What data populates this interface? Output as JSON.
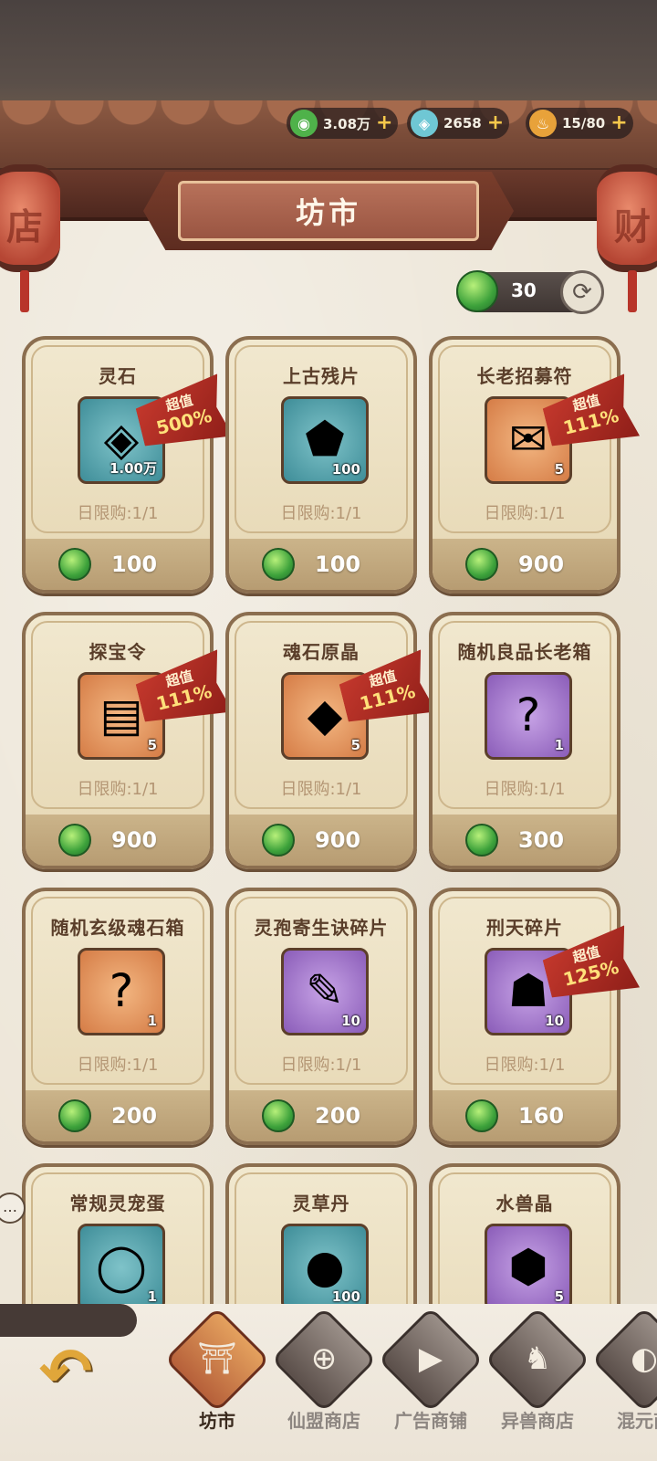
{
  "currencies": [
    {
      "icon": "jade-icon",
      "value": "3.08万",
      "color": "#4fb24a"
    },
    {
      "icon": "spirit-stone-icon",
      "value": "2658",
      "color": "#6fc7d4"
    },
    {
      "icon": "stamina-flame-icon",
      "value": "15/80",
      "color": "#e8a23a"
    }
  ],
  "lanterns": {
    "left": "店",
    "right": "财"
  },
  "title": "坊市",
  "refresh": {
    "cost": "30"
  },
  "items": [
    {
      "name": "灵石",
      "count": "1.00万",
      "limit": "日限购:1/1",
      "price": "100",
      "icon": "spirit-stone-icon",
      "glyph": "◈",
      "bg": "teal",
      "deal": {
        "label": "超值",
        "percent": "500%"
      }
    },
    {
      "name": "上古残片",
      "count": "100",
      "limit": "日限购:1/1",
      "price": "100",
      "icon": "ancient-fragment-icon",
      "glyph": "⬟",
      "bg": "teal",
      "deal": null
    },
    {
      "name": "长老招募符",
      "count": "5",
      "limit": "日限购:1/1",
      "price": "900",
      "icon": "recruit-talisman-icon",
      "glyph": "✉",
      "bg": "orange",
      "deal": {
        "label": "超值",
        "percent": "111%"
      }
    },
    {
      "name": "探宝令",
      "count": "5",
      "limit": "日限购:1/1",
      "price": "900",
      "icon": "treasure-token-icon",
      "glyph": "▤",
      "bg": "orange",
      "deal": {
        "label": "超值",
        "percent": "111%"
      }
    },
    {
      "name": "魂石原晶",
      "count": "5",
      "limit": "日限购:1/1",
      "price": "900",
      "icon": "soul-crystal-icon",
      "glyph": "◆",
      "bg": "orange",
      "deal": {
        "label": "超值",
        "percent": "111%"
      }
    },
    {
      "name": "随机良品长老箱",
      "count": "1",
      "limit": "日限购:1/1",
      "price": "300",
      "icon": "mystery-chest-icon",
      "glyph": "?",
      "bg": "purple",
      "deal": null
    },
    {
      "name": "随机玄级魂石箱",
      "count": "1",
      "limit": "日限购:1/1",
      "price": "200",
      "icon": "soul-stone-chest-icon",
      "glyph": "?",
      "bg": "orange",
      "deal": null
    },
    {
      "name": "灵孢寄生诀碎片",
      "count": "10",
      "limit": "日限购:1/1",
      "price": "200",
      "icon": "scroll-fragment-icon",
      "glyph": "✎",
      "bg": "purple",
      "deal": null
    },
    {
      "name": "刑天碎片",
      "count": "10",
      "limit": "日限购:1/1",
      "price": "160",
      "icon": "xingtian-fragment-icon",
      "glyph": "☗",
      "bg": "purple",
      "deal": {
        "label": "超值",
        "percent": "125%"
      }
    },
    {
      "name": "常规灵宠蛋",
      "count": "1",
      "limit": "",
      "price": "",
      "icon": "pet-egg-icon",
      "glyph": "◯",
      "bg": "teal",
      "deal": null
    },
    {
      "name": "灵草丹",
      "count": "100",
      "limit": "",
      "price": "",
      "icon": "herb-pill-icon",
      "glyph": "●",
      "bg": "teal",
      "deal": null
    },
    {
      "name": "水兽晶",
      "count": "5",
      "limit": "",
      "price": "",
      "icon": "water-beast-crystal-icon",
      "glyph": "⬢",
      "bg": "purple",
      "deal": null
    }
  ],
  "chat": "…",
  "back": "↶",
  "nav": [
    {
      "label": "坊市",
      "icon": "market-icon",
      "glyph": "⛩",
      "active": true
    },
    {
      "label": "仙盟商店",
      "icon": "alliance-shop-icon",
      "glyph": "⊕",
      "active": false
    },
    {
      "label": "广告商铺",
      "icon": "ad-shop-icon",
      "glyph": "▶",
      "active": false
    },
    {
      "label": "异兽商店",
      "icon": "beast-shop-icon",
      "glyph": "♞",
      "active": false
    },
    {
      "label": "混元商",
      "icon": "hunyuan-shop-icon",
      "glyph": "◐",
      "active": false
    }
  ]
}
